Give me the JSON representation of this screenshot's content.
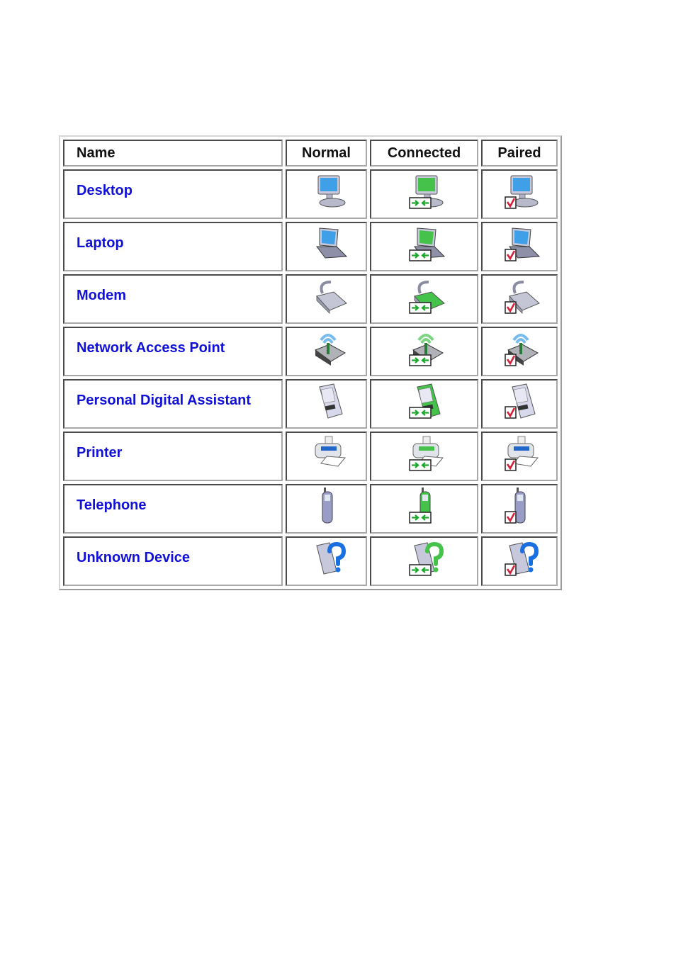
{
  "table": {
    "headers": [
      "Name",
      "Normal",
      "Connected",
      "Paired"
    ],
    "states": [
      "normal",
      "connected",
      "paired"
    ],
    "rows": [
      {
        "name": "Desktop",
        "device": "desktop"
      },
      {
        "name": "Laptop",
        "device": "laptop"
      },
      {
        "name": "Modem",
        "device": "modem"
      },
      {
        "name": "Network Access Point",
        "device": "access-point"
      },
      {
        "name": "Personal Digital Assistant",
        "device": "pda"
      },
      {
        "name": "Printer",
        "device": "printer"
      },
      {
        "name": "Telephone",
        "device": "telephone"
      },
      {
        "name": "Unknown Device",
        "device": "unknown"
      }
    ]
  },
  "colors": {
    "name_text": "#1010d8",
    "header_text": "#111111",
    "normal_accent": "#3fa0e8",
    "connected_accent": "#44c24a",
    "paired_check": "#d0203a",
    "device_body": "#9a9cc8"
  }
}
